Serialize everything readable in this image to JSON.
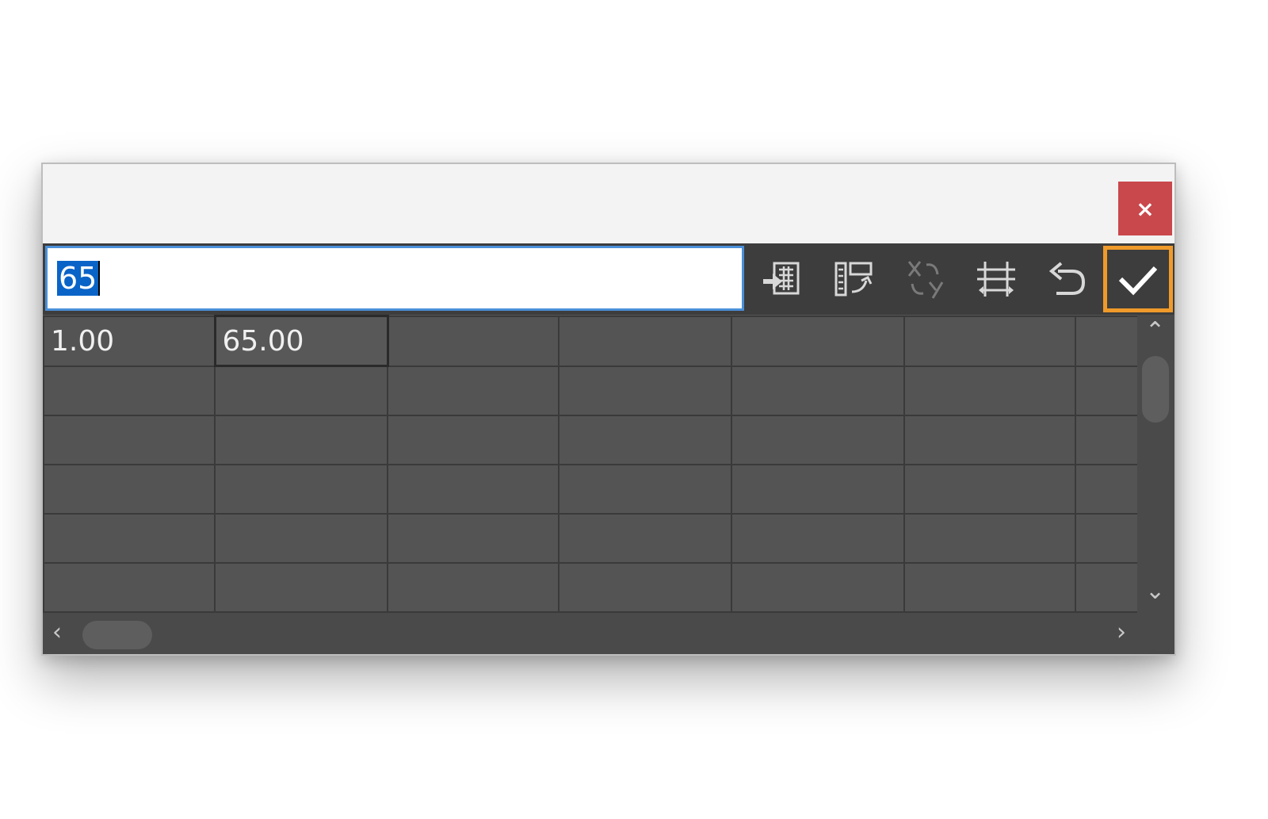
{
  "dialog": {
    "close_label": "×"
  },
  "input": {
    "value": "65"
  },
  "toolbar": {
    "tools": [
      {
        "name": "import-icon"
      },
      {
        "name": "swap-columns-icon"
      },
      {
        "name": "swap-xy-icon",
        "disabled": true
      },
      {
        "name": "fit-columns-icon"
      },
      {
        "name": "undo-icon"
      },
      {
        "name": "confirm-icon"
      }
    ]
  },
  "grid": {
    "rows": [
      [
        "1.00",
        "65.00",
        "",
        "",
        "",
        "",
        ""
      ],
      [
        "",
        "",
        "",
        "",
        "",
        "",
        ""
      ],
      [
        "",
        "",
        "",
        "",
        "",
        "",
        ""
      ],
      [
        "",
        "",
        "",
        "",
        "",
        "",
        ""
      ],
      [
        "",
        "",
        "",
        "",
        "",
        "",
        ""
      ],
      [
        "",
        "",
        "",
        "",
        "",
        "",
        ""
      ]
    ]
  },
  "colors": {
    "accent_border": "#ef9a2a",
    "close_button": "#c9484c",
    "selection": "#0a64c8",
    "input_focus": "#4a90d9"
  }
}
